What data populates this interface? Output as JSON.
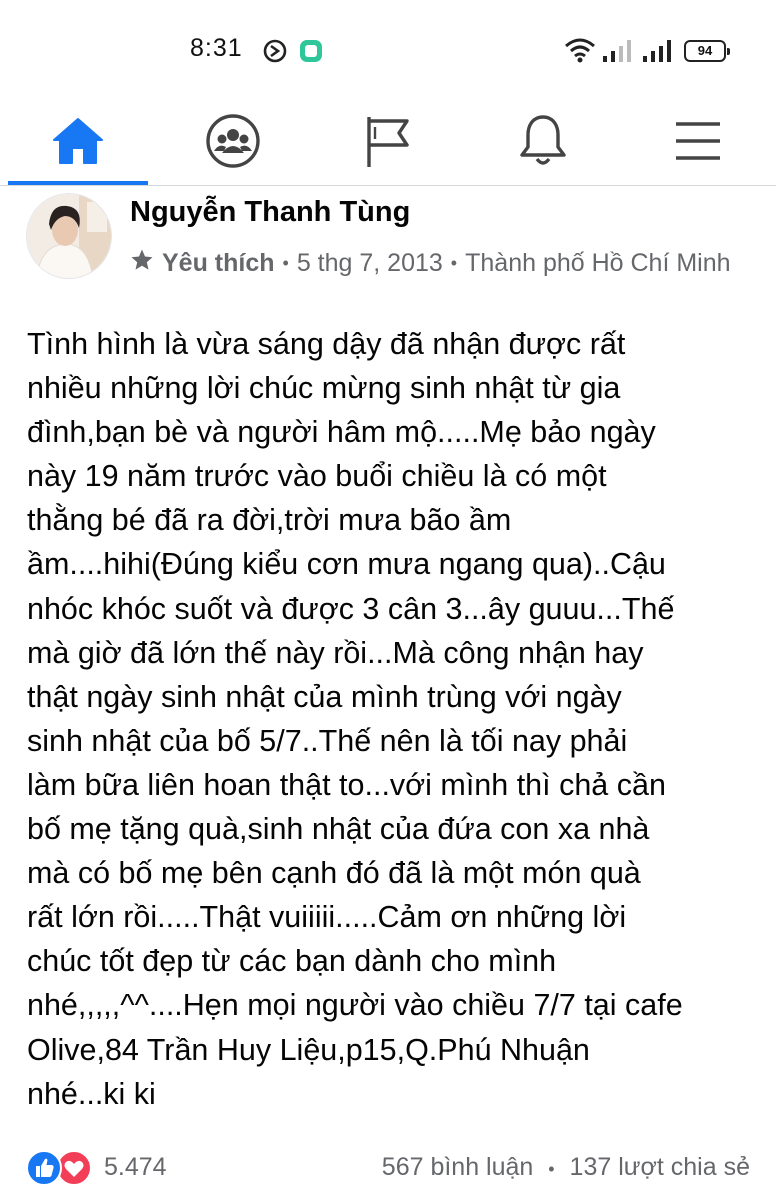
{
  "status_bar": {
    "time": "8:31",
    "battery": "94"
  },
  "nav": {
    "items": [
      {
        "icon": "home-icon",
        "active": true
      },
      {
        "icon": "groups-icon",
        "active": false
      },
      {
        "icon": "pages-flag-icon",
        "active": false
      },
      {
        "icon": "notifications-bell-icon",
        "active": false
      },
      {
        "icon": "menu-icon",
        "active": false
      }
    ],
    "accent": "#1877f2"
  },
  "post": {
    "author": "Nguyễn Thanh Tùng",
    "favorite_label": "Yêu thích",
    "date": "5 thg 7, 2013",
    "location": "Thành phố Hồ Chí Minh",
    "lines": [
      "Tình hình là vừa sáng dậy đã nhận được rất",
      "nhiều những lời chúc mừng sinh nhật từ gia",
      "đình,bạn bè và người hâm mộ.....Mẹ bảo ngày",
      "này 19 năm trước vào buổi chiều là có một",
      "thằng bé đã ra đời,trời mưa bão ầm",
      "ầm....hihi(Đúng kiểu cơn mưa ngang qua)..Cậu",
      "nhóc khóc suốt và được 3 cân 3...ây guuu...Thế",
      "mà giờ đã lớn thế này rồi...Mà công nhận hay",
      "thật ngày sinh nhật của mình trùng với ngày",
      "sinh nhật của bố 5/7..Thế nên là tối nay phải",
      "làm bữa liên hoan thật to...với mình thì chả cần",
      "bố mẹ tặng quà,sinh nhật của đứa con xa nhà",
      "mà có bố mẹ bên cạnh đó đã là một món quà",
      "rất lớn rồi.....Thật vuiiiii.....Cảm ơn những lời",
      "chúc tốt đẹp từ các bạn dành cho mình",
      "nhé,,,,,^^....Hẹn mọi người vào chiều 7/7 tại cafe",
      "Olive,84 Trần Huy Liệu,p15,Q.Phú Nhuận",
      "nhé...ki ki"
    ],
    "reaction_count": "5.474",
    "comments": "567 bình luận",
    "shares": "137 lượt chia sẻ"
  }
}
